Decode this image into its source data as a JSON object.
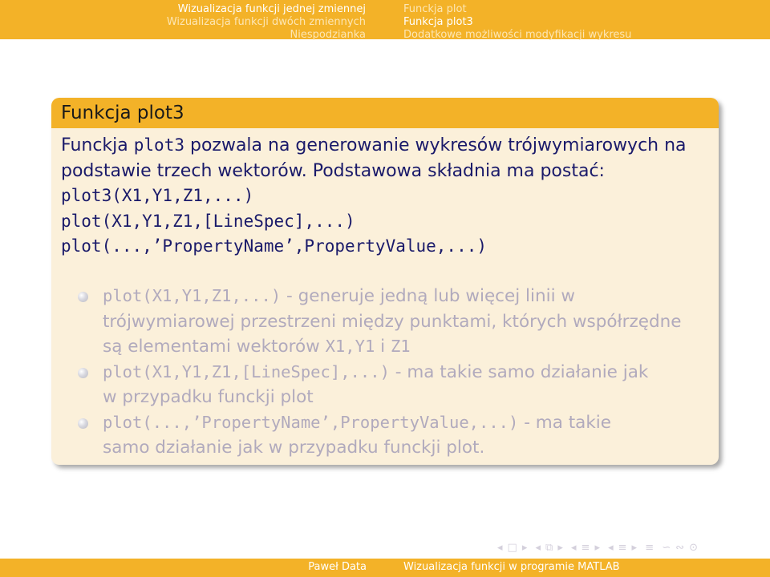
{
  "header": {
    "left_items": [
      "Wizualizacja funkcji jednej zmiennej",
      "Wizualizacja funkcji dwóch zmiennych",
      "Niespodzianka"
    ],
    "right_items": [
      "Funckja plot",
      "Funkcja plot3",
      "Dodatkowe możliwości modyfikacji wykresu"
    ]
  },
  "block": {
    "title": "Funkcja plot3",
    "intro_prefix": "Funckja ",
    "intro_code": "plot3",
    "intro_suffix": " pozwala na generowanie wykresów trójwymiarowych na",
    "intro_line2": "podstawie trzech wektorów. Podstawowa składnia ma postać:",
    "syntax": [
      "plot3(X1,Y1,Z1,...)",
      "plot(X1,Y1,Z1,[LineSpec],...)",
      "plot(...,’PropertyName’,PropertyValue,...)"
    ],
    "bullets": [
      {
        "code": "plot(X1,Y1,Z1,...)",
        "text1": " - generuje jedną lub więcej linii w",
        "text2": "trójwymiarowej przestrzeni między punktami, których współrzędne",
        "text3_prefix": "są elementami wektorów ",
        "text3_code": "X1,Y1",
        "text3_mid": " i ",
        "text3_code2": "Z1"
      },
      {
        "code": "plot(X1,Y1,Z1,[LineSpec],...)",
        "text1": " - ma takie samo działanie jak",
        "text2": "w przypadku funckji plot"
      },
      {
        "code": "plot(...,’PropertyName’,PropertyValue,...)",
        "text1": " - ma takie",
        "text2": "samo działanie jak w przypadku funckji plot."
      }
    ]
  },
  "nav_symbols": [
    "◂",
    "□",
    "▸",
    "◂",
    "⧉",
    "▸",
    "◂",
    "≡",
    "▸",
    "◂",
    "≡",
    "▸",
    "≡",
    "∽",
    "∾",
    "⊙"
  ],
  "footer": {
    "author": "Paweł Data",
    "title": "Wizualizacja funkcji w programie MATLAB"
  }
}
